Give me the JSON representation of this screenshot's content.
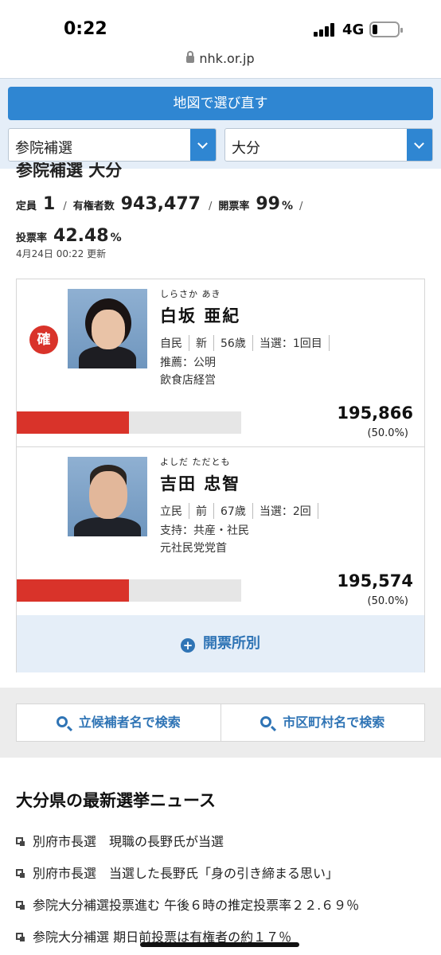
{
  "status": {
    "time": "0:22",
    "network": "4G",
    "battery_level": 0.15
  },
  "browser": {
    "url": "nhk.or.jp"
  },
  "controls": {
    "map_button": "地図で選び直す",
    "election_select": "参院補選",
    "region_select": "大分"
  },
  "summary": {
    "title": "参院補選 大分",
    "seats_label": "定員",
    "seats_value": "1",
    "voters_label": "有権者数",
    "voters_value": "943,477",
    "count_label": "開票率",
    "count_value": "99",
    "count_unit": "%",
    "turnout_label": "投票率",
    "turnout_value": "42.48",
    "turnout_unit": "%",
    "updated": "4月24日 00:22 更新",
    "sep": "/"
  },
  "candidates": [
    {
      "kana": "しらさか あき",
      "name": "白坂 亜紀",
      "badge": "確",
      "party": "自民",
      "status": "新",
      "age": "56歳",
      "term": "当選：1回目",
      "endorsement": "推薦：公明",
      "career": "飲食店経営",
      "votes": "195,866",
      "share": "(50.0%)",
      "share_value": 0.5
    },
    {
      "kana": "よしだ ただとも",
      "name": "吉田 忠智",
      "badge": "",
      "party": "立民",
      "status": "前",
      "age": "67歳",
      "term": "当選：2回",
      "endorsement": "支持：共産・社民",
      "career": "元社民党党首",
      "votes": "195,574",
      "share": "(50.0%)",
      "share_value": 0.5
    }
  ],
  "kaihyo_button": "開票所別",
  "search": {
    "by_candidate": "立候補者名で検索",
    "by_municipality": "市区町村名で検索"
  },
  "news": {
    "title": "大分県の最新選挙ニュース",
    "items": [
      "別府市長選　現職の長野氏が当選",
      "別府市長選　当選した長野氏「身の引き締まる思い」",
      "参院大分補選投票進む 午後６時の推定投票率２２.６９％",
      "参院大分補選 期日前投票は有権者の約１７％"
    ]
  },
  "colors": {
    "accent": "#2f86d2",
    "winner_red": "#d9332a",
    "link_blue": "#2f74b5"
  }
}
